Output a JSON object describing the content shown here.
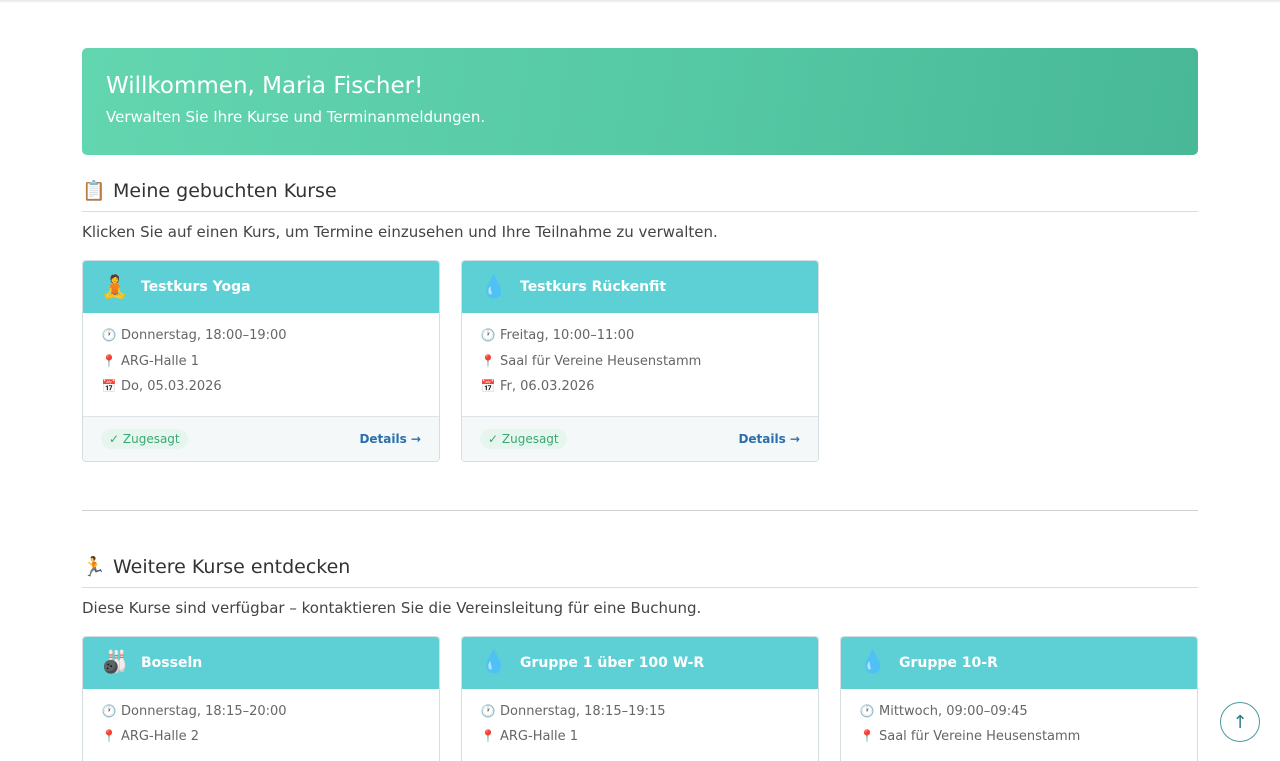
{
  "welcome": {
    "title": "Willkommen, Maria Fischer!",
    "subtitle": "Verwalten Sie Ihre Kurse und Terminanmeldungen."
  },
  "booked": {
    "icon": "📋",
    "icon_name": "clipboard-icon",
    "title": "Meine gebuchten Kurse",
    "description": "Klicken Sie auf einen Kurs, um Termine einzusehen und Ihre Teilnahme zu verwalten.",
    "courses": [
      {
        "icon": "🧘",
        "title": "Testkurs Yoga",
        "time": "Donnerstag, 18:00–19:00",
        "location": "ARG-Halle 1",
        "date": "Do, 05.03.2026",
        "status": "✓ Zugesagt",
        "details": "Details →"
      },
      {
        "icon": "💧",
        "title": "Testkurs Rückenfit",
        "time": "Freitag, 10:00–11:00",
        "location": "Saal für Vereine Heusenstamm",
        "date": "Fr, 06.03.2026",
        "status": "✓ Zugesagt",
        "details": "Details →"
      }
    ]
  },
  "discover": {
    "icon": "🏃",
    "icon_name": "runner-icon",
    "title": "Weitere Kurse entdecken",
    "description": "Diese Kurse sind verfügbar – kontaktieren Sie die Vereinsleitung für eine Buchung.",
    "courses": [
      {
        "icon": "🎳",
        "title": "Bosseln",
        "time": "Donnerstag, 18:15–20:00",
        "location": "ARG-Halle 2"
      },
      {
        "icon": "💧",
        "title": "Gruppe 1 über 100 W-R",
        "time": "Donnerstag, 18:15–19:15",
        "location": "ARG-Halle 1"
      },
      {
        "icon": "💧",
        "title": "Gruppe 10-R",
        "time": "Mittwoch, 09:00–09:45",
        "location": "Saal für Vereine Heusenstamm"
      }
    ]
  },
  "icons": {
    "clock": "🕐",
    "pin": "📍",
    "calendar": "📅",
    "up": "↑"
  },
  "colors": {
    "card_header": "#5dd0d6",
    "welcome": "#55c8a4",
    "accent_link": "#2a6fad",
    "badge": "#3aa873"
  }
}
